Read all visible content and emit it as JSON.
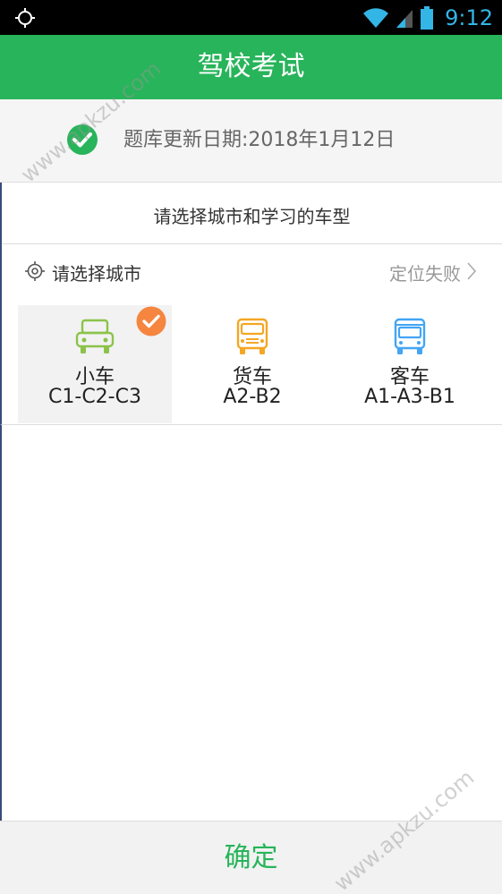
{
  "status_bar": {
    "time": "9:12",
    "icons": [
      "location-icon",
      "wifi-icon",
      "signal-icon",
      "battery-icon"
    ],
    "time_color": "#33b5e5"
  },
  "app_bar": {
    "title": "驾校考试",
    "color": "#28b45a"
  },
  "update": {
    "text": "题库更新日期:2018年1月12日",
    "icon": "check-circle-icon"
  },
  "selector": {
    "title": "请选择城市和学习的车型",
    "city_label": "请选择城市",
    "city_status": "定位失败",
    "icon": "locate-icon"
  },
  "vehicles": [
    {
      "name": "小车",
      "code": "C1-C2-C3",
      "icon": "car-icon",
      "color": "#8bc34a",
      "selected": true
    },
    {
      "name": "货车",
      "code": "A2-B2",
      "icon": "truck-icon",
      "color": "#f5a623",
      "selected": false
    },
    {
      "name": "客车",
      "code": "A1-A3-B1",
      "icon": "bus-icon",
      "color": "#42a5f5",
      "selected": false
    }
  ],
  "selected_badge_color": "#f5853f",
  "confirm": {
    "label": "确定"
  },
  "watermarks": [
    "www.apkzu.com",
    "www.apkzu.com"
  ]
}
